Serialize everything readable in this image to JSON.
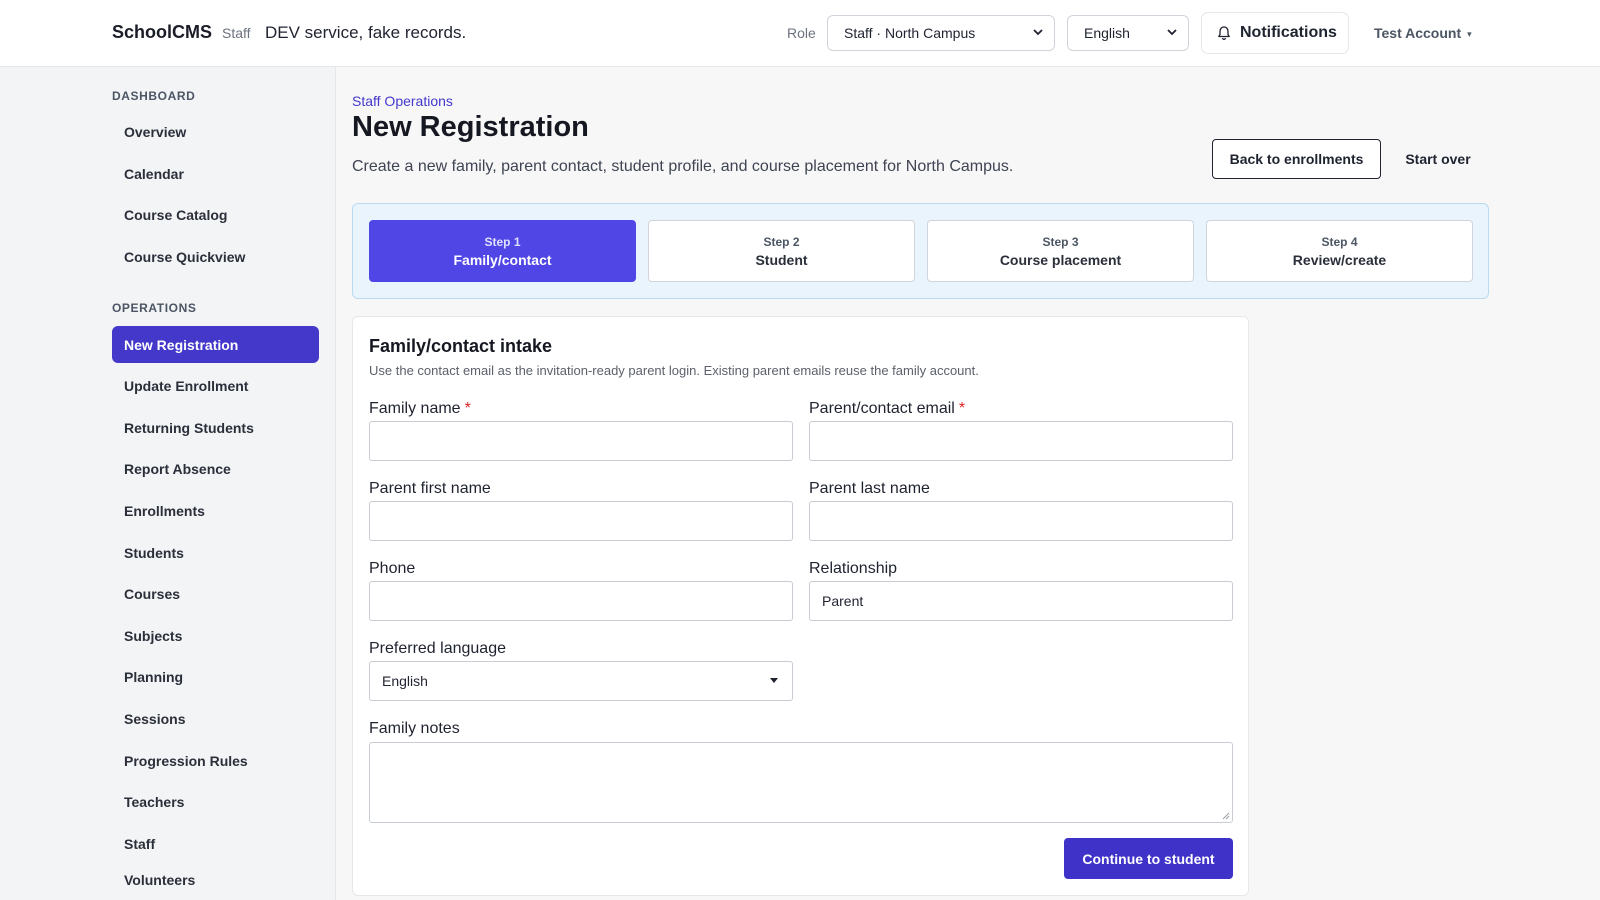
{
  "header": {
    "brand": "SchoolCMS",
    "role_tag": "Staff",
    "dev_note": "DEV service, fake records.",
    "role_label": "Role",
    "role_select_value": "Staff · North Campus",
    "language_select_value": "English",
    "notifications_label": "Notifications",
    "account_label": "Test Account",
    "account_caret": "▾"
  },
  "sidebar": {
    "sections": [
      {
        "title": "DASHBOARD",
        "items": [
          {
            "label": "Overview"
          },
          {
            "label": "Calendar"
          },
          {
            "label": "Course Catalog"
          },
          {
            "label": "Course Quickview"
          }
        ]
      },
      {
        "title": "OPERATIONS",
        "items": [
          {
            "label": "New Registration",
            "active": true
          },
          {
            "label": "Update Enrollment"
          },
          {
            "label": "Returning Students"
          },
          {
            "label": "Report Absence"
          },
          {
            "label": "Enrollments"
          },
          {
            "label": "Students"
          },
          {
            "label": "Courses"
          },
          {
            "label": "Subjects"
          },
          {
            "label": "Planning"
          },
          {
            "label": "Sessions"
          },
          {
            "label": "Progression Rules"
          },
          {
            "label": "Teachers"
          },
          {
            "label": "Staff"
          },
          {
            "label": "Volunteers"
          }
        ]
      }
    ]
  },
  "main": {
    "breadcrumb": "Staff Operations",
    "title": "New Registration",
    "subtitle": "Create a new family, parent contact, student profile, and course placement for North Campus.",
    "back_button": "Back to enrollments",
    "start_over_button": "Start over",
    "steps": [
      {
        "num": "Step 1",
        "name": "Family/contact",
        "active": true
      },
      {
        "num": "Step 2",
        "name": "Student",
        "active": false
      },
      {
        "num": "Step 3",
        "name": "Course placement",
        "active": false
      },
      {
        "num": "Step 4",
        "name": "Review/create",
        "active": false
      }
    ],
    "form": {
      "title": "Family/contact intake",
      "subtitle": "Use the contact email as the invitation-ready parent login. Existing parent emails reuse the family account.",
      "required_marker": "*",
      "family_name_label": "Family name",
      "family_name_value": "",
      "email_label": "Parent/contact email",
      "email_value": "",
      "parent_first_label": "Parent first name",
      "parent_first_value": "",
      "parent_last_label": "Parent last name",
      "parent_last_value": "",
      "phone_label": "Phone",
      "phone_value": "",
      "relationship_label": "Relationship",
      "relationship_value": "Parent",
      "language_label": "Preferred language",
      "language_value": "English",
      "notes_label": "Family notes",
      "notes_value": "",
      "continue_button": "Continue to student"
    }
  },
  "colors": {
    "accent": "#4338ca",
    "step_active": "#4f46e5",
    "stepper_bg": "#eaf4fc",
    "required": "#dc2626"
  },
  "icons": {
    "notifications": "bell-icon",
    "select_caret": "chevron-down-icon",
    "account_caret": "caret-down-icon"
  }
}
